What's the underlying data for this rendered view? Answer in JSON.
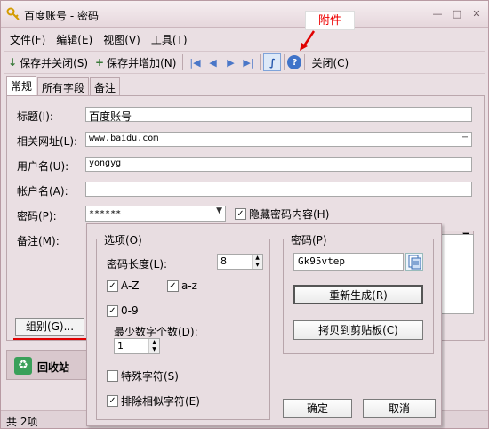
{
  "window": {
    "title": "百度账号 - 密码"
  },
  "annotation": {
    "text": "附件",
    "color": "#e00000"
  },
  "menu": [
    "文件(F)",
    "编辑(E)",
    "视图(V)",
    "工具(T)"
  ],
  "toolbar": {
    "save_close": "保存并关闭(S)",
    "save_add": "保存并增加(N)",
    "close": "关闭(C)"
  },
  "tabs": [
    "常规",
    "所有字段",
    "备注"
  ],
  "form": {
    "title_label": "标题(I):",
    "title_value": "百度账号",
    "url_label": "相关网址(L):",
    "url_value": "www.baidu.com",
    "user_label": "用户名(U):",
    "user_value": "yongyg",
    "account_label": "帐户名(A):",
    "account_value": "",
    "password_label": "密码(P):",
    "password_value": "******",
    "hide_label": "隐藏密码内容(H)",
    "note_label": "备注(M):"
  },
  "group_button": "组别(G)...",
  "recycle": {
    "label": "回收站"
  },
  "status": {
    "text": "共 2项"
  },
  "popup": {
    "options_title": "选项(O)",
    "length_label": "密码长度(L):",
    "length_value": "8",
    "az_label": "A-Z",
    "az_lower_label": "a-z",
    "digits_label": "0-9",
    "min_digits_label": "最少数字个数(D):",
    "min_digits_value": "1",
    "special_label": "特殊字符(S)",
    "exclude_label": "排除相似字符(E)",
    "password_title": "密码(P)",
    "generated": "Gk95vtep",
    "regen_button": "重新生成(R)",
    "copy_button": "拷贝到剪贴板(C)",
    "ok_button": "确定",
    "cancel_button": "取消"
  }
}
